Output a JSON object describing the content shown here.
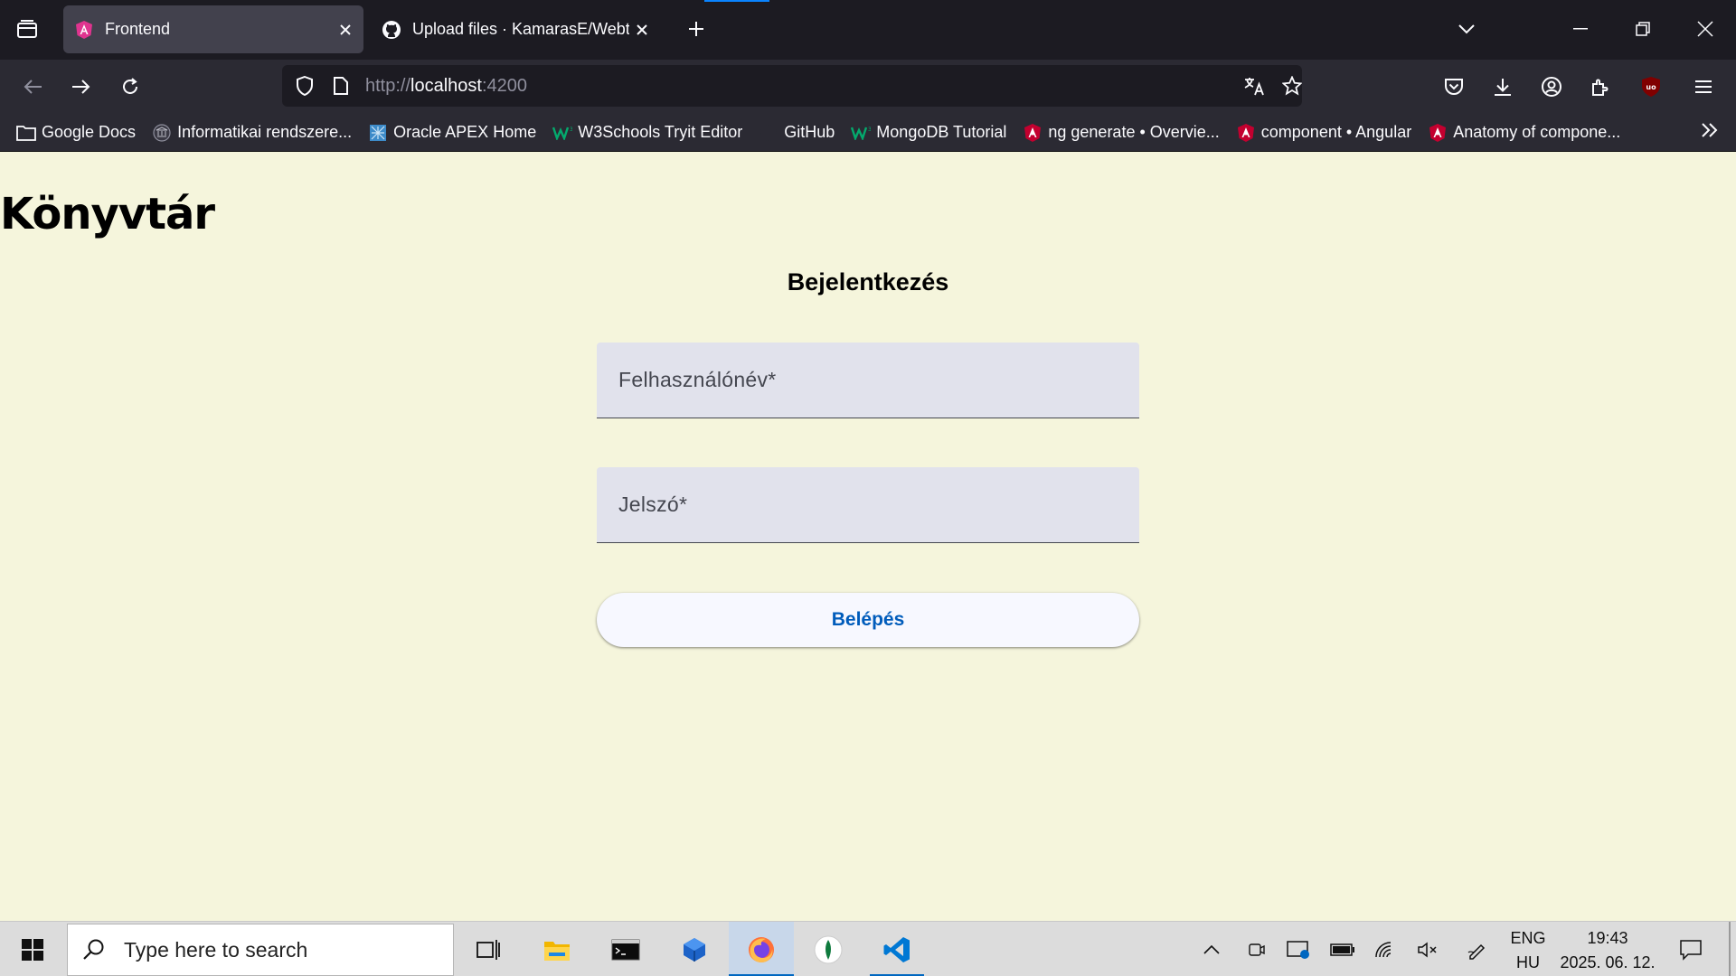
{
  "browser": {
    "tabs": [
      {
        "title": "Frontend",
        "active": true
      },
      {
        "title": "Upload files · KamarasE/Webtec",
        "active": false
      }
    ],
    "url": {
      "scheme": "http://",
      "host": "localhost",
      "port": ":4200"
    },
    "bookmarks": [
      {
        "label": "Google Docs",
        "icon": "folder-icon"
      },
      {
        "label": "Informatikai rendszere...",
        "icon": "university-icon"
      },
      {
        "label": "Oracle APEX Home",
        "icon": "apex-icon"
      },
      {
        "label": "W3Schools Tryit Editor",
        "icon": "w3schools-icon"
      },
      {
        "label": "GitHub",
        "icon": "github-icon"
      },
      {
        "label": "MongoDB Tutorial",
        "icon": "w3schools-icon"
      },
      {
        "label": "ng generate • Overvie...",
        "icon": "angular-icon"
      },
      {
        "label": "component • Angular",
        "icon": "angular-icon"
      },
      {
        "label": "Anatomy of compone...",
        "icon": "angular-icon"
      }
    ]
  },
  "page": {
    "app_title": "Könyvtár",
    "login_title": "Bejelentkezés",
    "username_placeholder": "Felhasználónév*",
    "password_placeholder": "Jelszó*",
    "login_button": "Belépés"
  },
  "taskbar": {
    "search_placeholder": "Type here to search",
    "lang_top": "ENG",
    "lang_bottom": "HU",
    "time": "19:43",
    "date": "2025. 06. 12."
  },
  "colors": {
    "page_bg": "#f5f5dc",
    "field_bg": "#e1e2ec",
    "button_text": "#005cbb",
    "chrome_dark": "#1c1b22",
    "chrome_mid": "#2b2a33"
  }
}
